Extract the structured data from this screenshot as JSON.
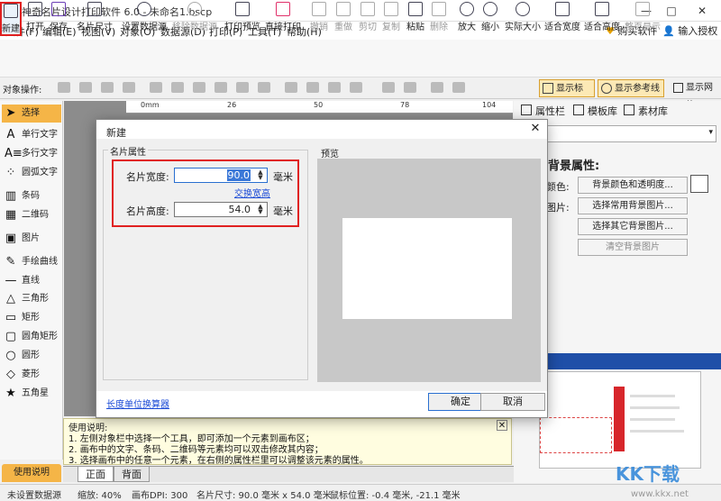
{
  "window": {
    "title": "神奇名片设计打印软件 6.0 - 未命名1.bscp",
    "min": "—",
    "max": "□",
    "close": "✕"
  },
  "menu": [
    "文件(F)",
    "编辑(E)",
    "视图(V)",
    "对象(O)",
    "数据源(D)",
    "打印(P)",
    "工具(T)",
    "帮助(H)"
  ],
  "menu_right": {
    "buy": "购买软件",
    "auth": "输入授权码"
  },
  "toolbar": [
    "新建",
    "打开",
    "保存",
    "名片尺寸",
    "设置数据源",
    "移除数据源",
    "打印预览",
    "直接打印",
    "撤销",
    "重做",
    "剪切",
    "复制",
    "粘贴",
    "删除",
    "放大",
    "缩小",
    "实际大小",
    "适合宽度",
    "适合高度",
    "整页显示"
  ],
  "objbar": {
    "label": "对象操作:",
    "show_ruler": "显示标尺",
    "show_guides": "显示参考线",
    "show_grid": "显示网格"
  },
  "tools": [
    "选择",
    "单行文字",
    "多行文字",
    "圆弧文字",
    "条码",
    "二维码",
    "图片",
    "手绘曲线",
    "直线",
    "三角形",
    "矩形",
    "圆角矩形",
    "圆形",
    "菱形",
    "五角星"
  ],
  "help_tab": "使用说明",
  "ruler": [
    "0mm",
    "26",
    "50",
    "78",
    "104"
  ],
  "right_panel": {
    "tabs": [
      "属性栏",
      "模板库",
      "素材库"
    ],
    "title": "背景属性:",
    "color_label": "颜色:",
    "image_label": "图片:",
    "btn_color": "背景颜色和透明度...",
    "btn_common": "选择常用背景图片...",
    "btn_other": "选择其它背景图片...",
    "btn_clear": "清空背景图片"
  },
  "help": {
    "title": "使用说明:",
    "lines": [
      "1. 左侧对象栏中选择一个工具，即可添加一个元素到画布区；",
      "2. 画布中的文字、条码、二维码等元素均可以双击修改其内容；",
      "3. 选择画布中的任意一个元素，在右侧的属性栏里可以调整该元素的属性。"
    ],
    "close": "✕"
  },
  "page_tabs": [
    "正面",
    "背面"
  ],
  "status": {
    "datasource": "未设置数据源",
    "zoom": "缩放: 40%",
    "dpi": "画布DPI: 300",
    "size": "名片尺寸: 90.0 毫米 x 54.0 毫米",
    "mouse": "鼠标位置: -0.4 毫米, -21.1 毫米"
  },
  "dialog": {
    "title": "新建",
    "close": "✕",
    "group_title": "名片属性",
    "preview_title": "预览",
    "width_label": "名片宽度:",
    "width_value": "90.0",
    "height_label": "名片高度:",
    "height_value": "54.0",
    "unit": "毫米",
    "swap": "交换宽高",
    "unit_conv": "长度单位换算器",
    "ok": "确定",
    "cancel": "取消"
  },
  "watermark": {
    "text": "KK下载",
    "url": "www.kkx.net"
  }
}
